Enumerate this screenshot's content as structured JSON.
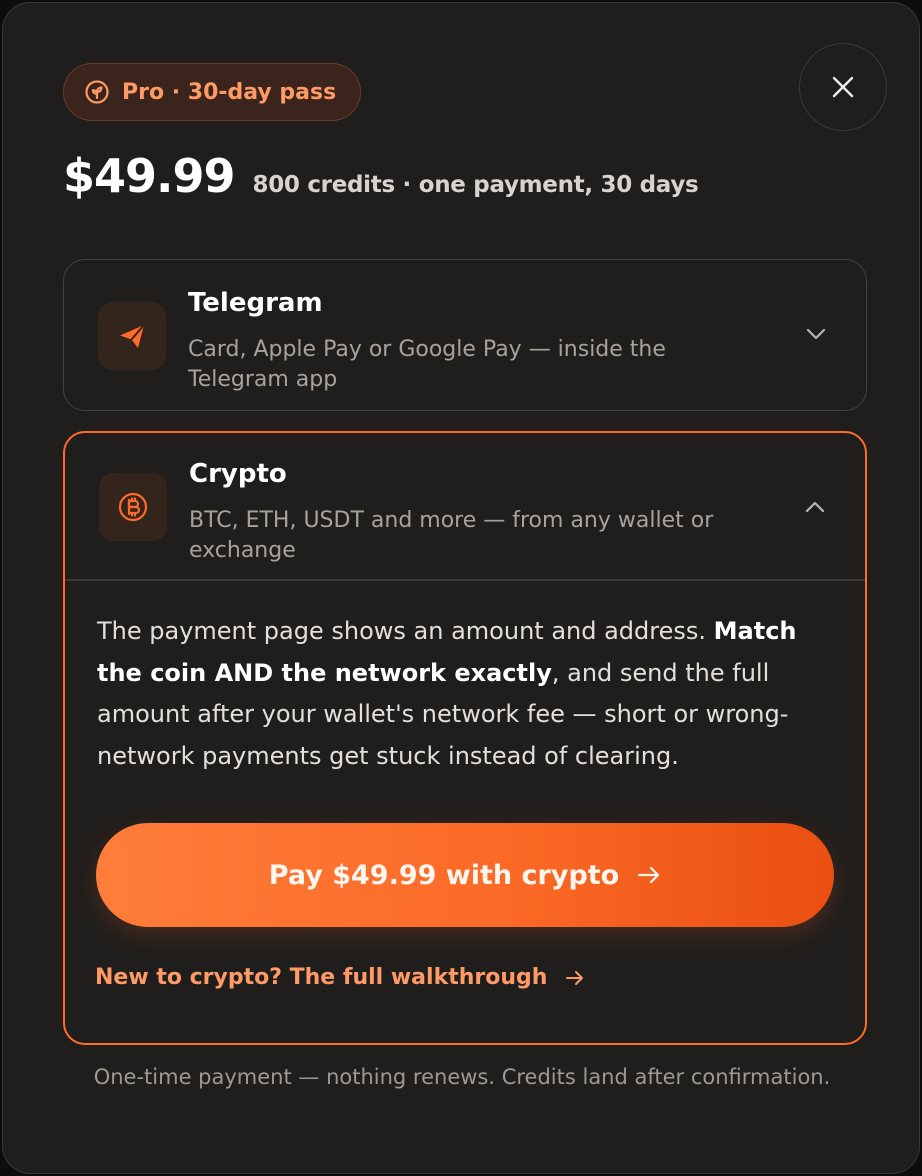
{
  "plan": {
    "badge_label": "Pro · 30-day pass",
    "badge_icon": "seedling-icon",
    "price": "$49.99",
    "price_sub": "800 credits · one payment, 30 days"
  },
  "close": {
    "icon": "close-icon"
  },
  "options": [
    {
      "title": "Telegram",
      "description": "Card, Apple Pay or Google Pay — inside the Telegram app",
      "icon": "paper-plane-icon",
      "expanded": false
    },
    {
      "title": "Crypto",
      "description": "BTC, ETH, USDT and more — from any wallet or exchange",
      "icon": "bitcoin-icon",
      "expanded": true,
      "details": {
        "text_1": "The payment page shows an amount and address. ",
        "text_bold": "Match the coin AND the network exactly",
        "text_2": ", and send the full amount after your wallet's network fee — short or wrong-network payments get stuck instead of clearing."
      },
      "pay_button": "Pay $49.99 with crypto",
      "walkthrough_link": "New to crypto? The full walkthrough"
    }
  ],
  "footer": "One-time payment — nothing renews. Credits land after confirmation.",
  "colors": {
    "accent": "#ff6a2b",
    "accent_text": "#ff9a66",
    "background": "#201e1c"
  }
}
